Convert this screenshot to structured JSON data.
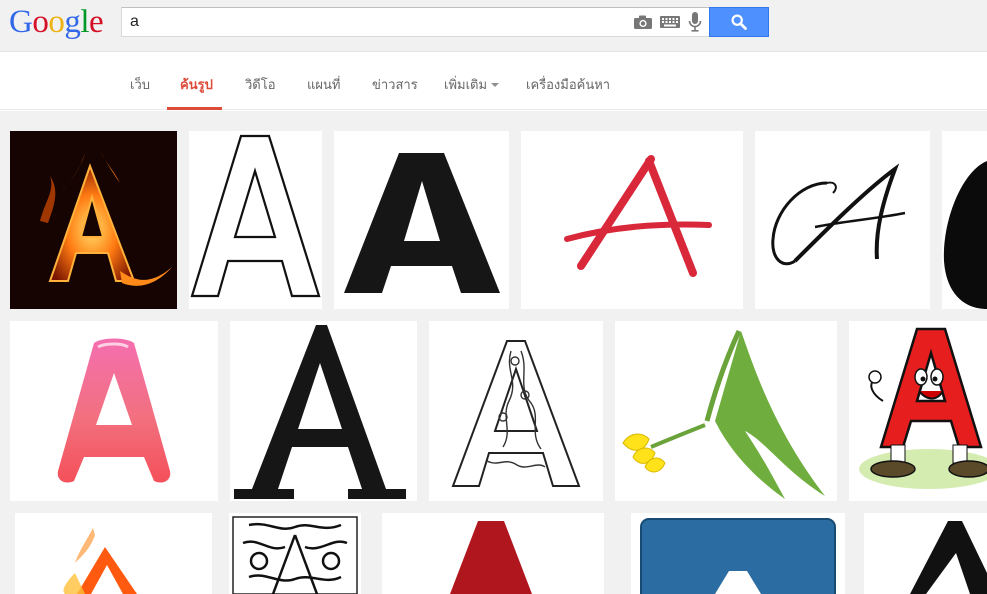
{
  "header": {
    "logo_letters": [
      "G",
      "o",
      "o",
      "g",
      "l",
      "e"
    ],
    "logo_colors": [
      "#3369e8",
      "#d50f25",
      "#eeb211",
      "#3369e8",
      "#009925",
      "#d50f25"
    ],
    "search": {
      "value": "a",
      "placeholder": ""
    },
    "icons": [
      "camera-icon",
      "keyboard-icon",
      "microphone-icon",
      "magnifier-icon"
    ]
  },
  "nav": {
    "items": [
      {
        "label": "เว็บ",
        "active": false
      },
      {
        "label": "ค้นรูป",
        "active": true
      },
      {
        "label": "วิดีโอ",
        "active": false
      },
      {
        "label": "แผนที่",
        "active": false
      },
      {
        "label": "ข่าวสาร",
        "active": false
      },
      {
        "label": "เพิ่มเติม",
        "active": false
      },
      {
        "label": "เครื่องมือค้นหา",
        "active": false
      }
    ]
  },
  "colors": {
    "accent": "#dd4b39",
    "search_button": "#4d90fe",
    "header_bg": "#f1f1f1"
  },
  "results": {
    "row1": [
      "fire-letter-a",
      "outline-letter-a",
      "bold-black-letter-a",
      "red-brush-letter-a",
      "script-letter-a",
      "black-partial-letter"
    ],
    "row2": [
      "pink-gradient-letter-a",
      "serif-letter-a",
      "ornate-letter-a",
      "tulip-letter-a",
      "cartoon-letter-a"
    ],
    "row3": [
      "fire-letter-a-partial",
      "decorative-letter-a-partial",
      "red-letter-a-partial",
      "blue-tile-letter-a-partial",
      "black-letter-a-partial"
    ]
  }
}
